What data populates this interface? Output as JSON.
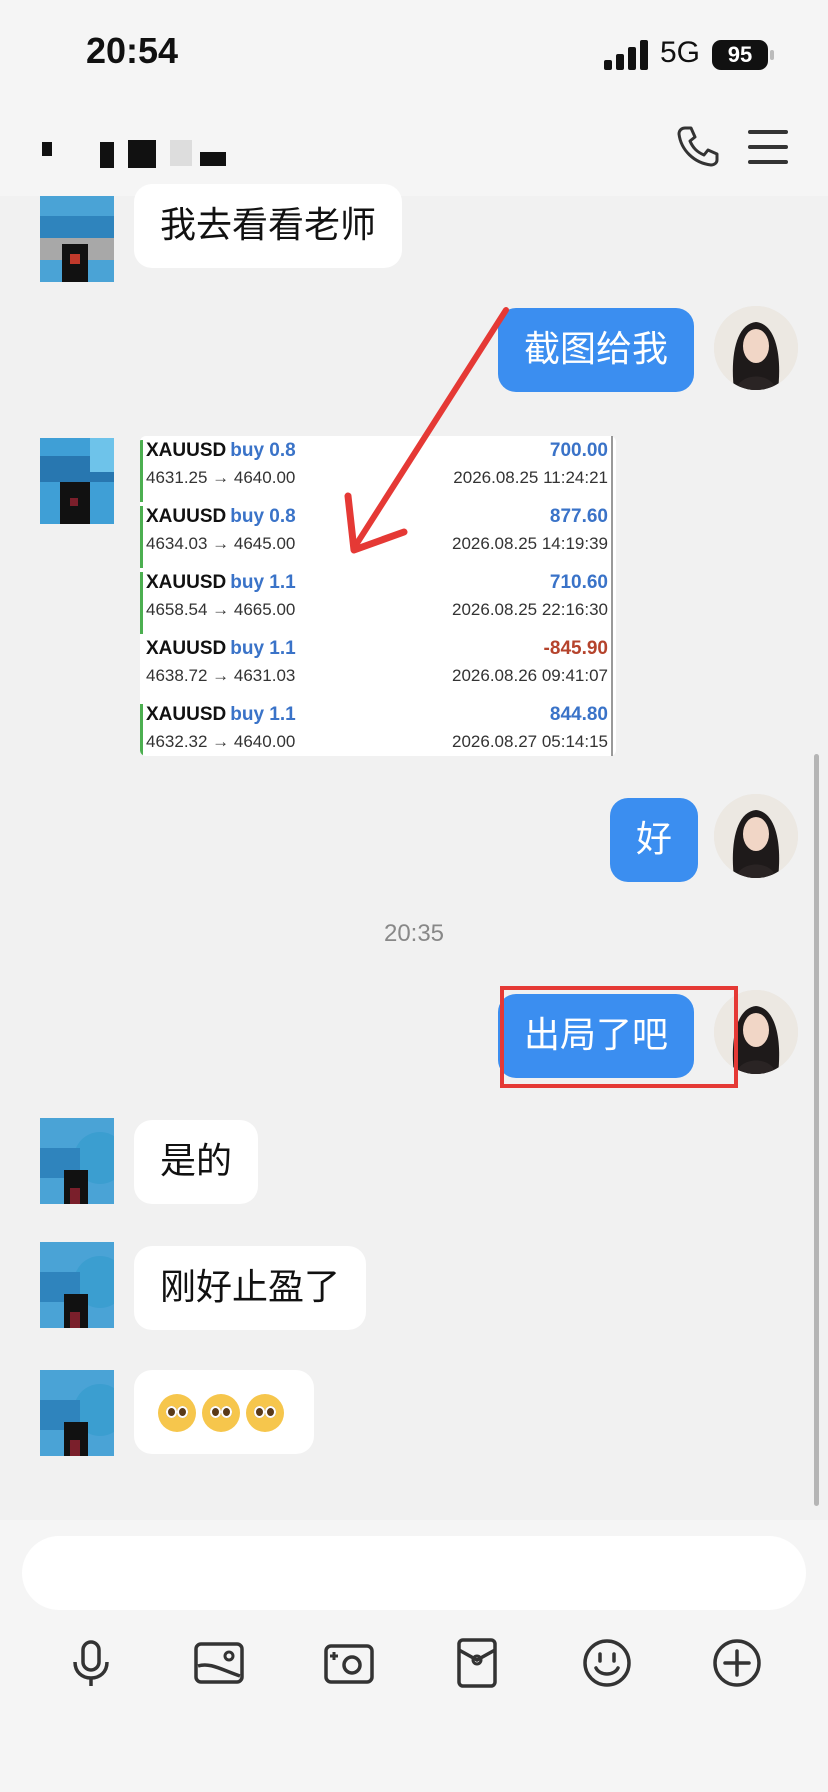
{
  "status_bar": {
    "time": "20:54",
    "network": "5G",
    "battery": "95"
  },
  "header": {
    "call_icon": "phone-icon",
    "menu_icon": "menu-icon"
  },
  "messages": [
    {
      "id": "m1",
      "side": "in",
      "text": "我去看看老师"
    },
    {
      "id": "m2",
      "side": "out",
      "text": "截图给我"
    },
    {
      "id": "m3",
      "side": "in",
      "type": "image",
      "trades": [
        {
          "symbol": "XAUUSD",
          "side": "buy 0.8",
          "prices": "4631.25 → 4640.00",
          "profit": "700.00",
          "time": "2026.08.25 11:24:21"
        },
        {
          "symbol": "XAUUSD",
          "side": "buy 0.8",
          "prices": "4634.03 → 4645.00",
          "profit": "877.60",
          "time": "2026.08.25 14:19:39"
        },
        {
          "symbol": "XAUUSD",
          "side": "buy 1.1",
          "prices": "4658.54 → 4665.00",
          "profit": "710.60",
          "time": "2026.08.25 22:16:30"
        },
        {
          "symbol": "XAUUSD",
          "side": "buy 1.1",
          "prices": "4638.72 → 4631.03",
          "profit": "-845.90",
          "time": "2026.08.26 09:41:07"
        },
        {
          "symbol": "XAUUSD",
          "side": "buy 1.1",
          "prices": "4632.32 → 4640.00",
          "profit": "844.80",
          "time": "2026.08.27 05:14:15"
        }
      ]
    },
    {
      "id": "m4",
      "side": "out",
      "text": "好"
    },
    {
      "id": "m5",
      "side": "out",
      "text": "出局了吧"
    },
    {
      "id": "m6",
      "side": "in",
      "text": "是的"
    },
    {
      "id": "m7",
      "side": "in",
      "text": "刚好止盈了"
    },
    {
      "id": "m8",
      "side": "in",
      "type": "emoji",
      "count": 3
    }
  ],
  "timestamp": "20:35",
  "colors": {
    "profit_positive": "#3a73c8",
    "profit_negative": "#b5432c",
    "bubble_out": "#3b8ef0",
    "annotation": "#e53935"
  },
  "toolbar": [
    "mic-icon",
    "image-icon",
    "camera-icon",
    "red-packet-icon",
    "emoji-icon",
    "plus-icon"
  ]
}
